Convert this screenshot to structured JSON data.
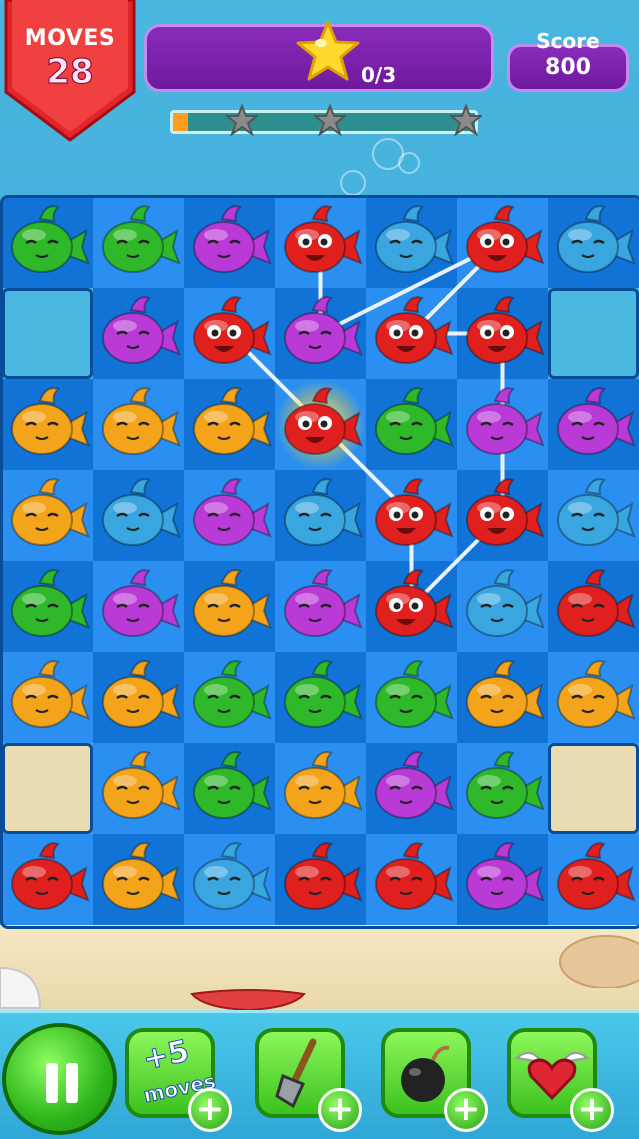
{
  "hud": {
    "moves_label": "MOVES",
    "moves_value": "28",
    "goal_count": "0/3",
    "score_label": "Score",
    "score_value": "800",
    "goal_progress_fraction": 0.05,
    "progress_stars": 3
  },
  "board": {
    "rows": 8,
    "cols": 7,
    "holes": [
      [
        1,
        0
      ],
      [
        1,
        6
      ],
      [
        6,
        0
      ],
      [
        6,
        6
      ]
    ],
    "grid": [
      [
        "green",
        "green",
        "purple",
        "red",
        "blue",
        "red",
        "blue"
      ],
      [
        null,
        "purple",
        "red",
        "purple",
        "red",
        "red",
        null
      ],
      [
        "orange",
        "orange",
        "orange",
        "red",
        "green",
        "purple",
        "purple"
      ],
      [
        "orange",
        "blue",
        "purple",
        "blue",
        "red",
        "red",
        "blue"
      ],
      [
        "green",
        "purple",
        "orange",
        "purple",
        "red",
        "blue",
        "red"
      ],
      [
        "orange",
        "orange",
        "green",
        "green",
        "green",
        "orange",
        "orange"
      ],
      [
        null,
        "orange",
        "green",
        "orange",
        "purple",
        "green",
        null
      ],
      [
        "red",
        "orange",
        "blue",
        "red",
        "red",
        "purple",
        "red"
      ]
    ],
    "highlight": [
      2,
      3
    ],
    "chain": [
      [
        1,
        2
      ],
      [
        2,
        3
      ],
      [
        3,
        4
      ],
      [
        4,
        4
      ],
      [
        3,
        5
      ],
      [
        1,
        5
      ],
      [
        1,
        4
      ],
      [
        0,
        5
      ],
      [
        1,
        3
      ],
      [
        0,
        3
      ]
    ]
  },
  "colors": {
    "red": "#e0201e",
    "green": "#2fb82a",
    "purple": "#b93ad6",
    "blue": "#3aa6e0",
    "orange": "#f4a41a"
  },
  "toolbar": {
    "pause_icon": "pause-icon",
    "boosters": [
      {
        "name": "extra-moves-booster",
        "top_text": "+5",
        "bottom_text": "moves"
      },
      {
        "name": "shovel-booster",
        "icon": "shovel-icon"
      },
      {
        "name": "bomb-booster",
        "icon": "bomb-icon"
      },
      {
        "name": "heart-booster",
        "icon": "winged-heart-icon"
      }
    ]
  }
}
